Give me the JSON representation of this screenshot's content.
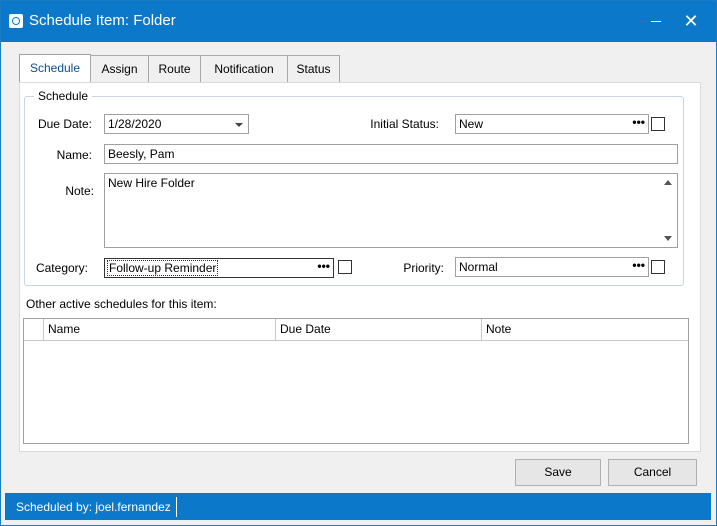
{
  "window": {
    "title": "Schedule Item: Folder",
    "minimize_glyph": "—",
    "close_glyph": "✕"
  },
  "tabs": [
    {
      "label": "Schedule",
      "active": true
    },
    {
      "label": "Assign",
      "active": false
    },
    {
      "label": "Route",
      "active": false
    },
    {
      "label": "Notification",
      "active": false
    },
    {
      "label": "Status",
      "active": false
    }
  ],
  "schedule_group": {
    "legend": "Schedule",
    "due_date_label": "Due Date:",
    "due_date_value": "1/28/2020",
    "initial_status_label": "Initial Status:",
    "initial_status_value": "New",
    "name_label": "Name:",
    "name_value": "Beesly, Pam",
    "note_label": "Note:",
    "note_value": "New Hire Folder",
    "category_label": "Category:",
    "category_value": "Follow-up Reminder",
    "priority_label": "Priority:",
    "priority_value": "Normal",
    "ellipsis": "•••"
  },
  "other_schedules": {
    "label": "Other active schedules for this item:",
    "columns": [
      "Name",
      "Due Date",
      "Note"
    ],
    "rows": []
  },
  "buttons": {
    "save": "Save",
    "cancel": "Cancel"
  },
  "statusbar": {
    "text": "Scheduled by: joel.fernandez"
  },
  "colors": {
    "accent": "#0b78c9"
  }
}
